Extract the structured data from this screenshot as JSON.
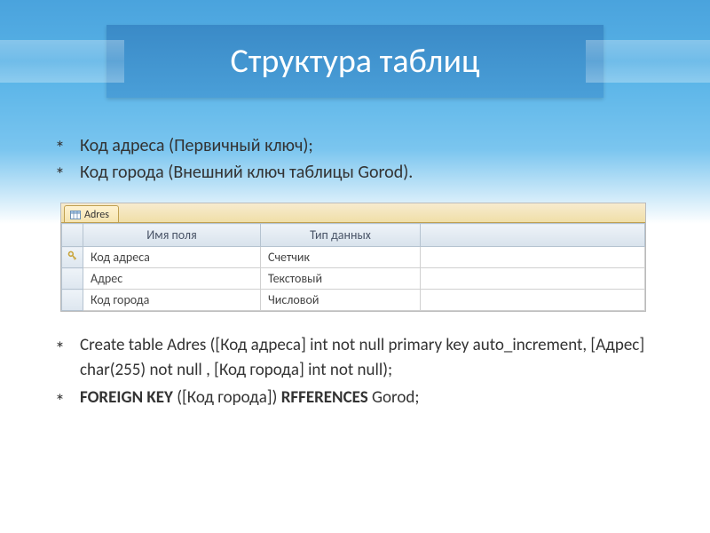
{
  "title": "Структура таблиц",
  "top_bullets": [
    "Код адреса (Первичный ключ);",
    "Код города (Внешний ключ таблицы Gorod)."
  ],
  "table": {
    "tab_label": "Adres",
    "headers": {
      "col1": "Имя поля",
      "col2": "Тип данных"
    },
    "rows": [
      {
        "name": "Код адреса",
        "type": "Счетчик",
        "pk": true
      },
      {
        "name": "Адрес",
        "type": "Текстовый",
        "pk": false
      },
      {
        "name": "Код города",
        "type": "Числовой",
        "pk": false
      }
    ]
  },
  "bottom_bullets": [
    {
      "plain": "Create table Adres ([Код адреса] int not null primary key auto_increment, [Адрес] char(255) not null , [Код города] int  not null);"
    },
    {
      "bold_prefix": "FOREIGN KEY",
      "mid": " ([Код города]) ",
      "bold_mid": "RFFERENCES",
      "tail": " Gorod;"
    }
  ]
}
